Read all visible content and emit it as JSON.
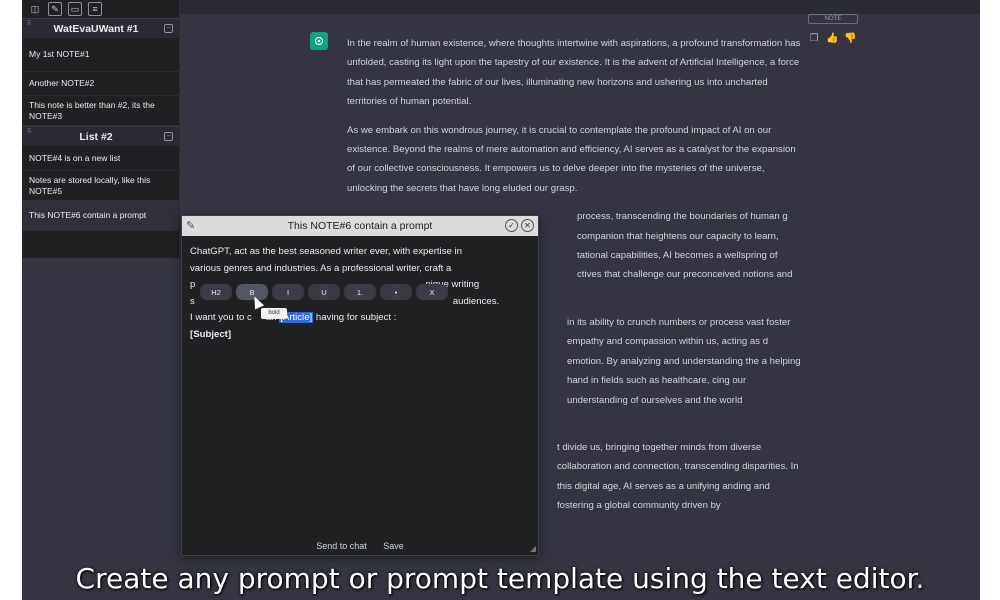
{
  "sidebar": {
    "folders": [
      {
        "name": "WatEvaUWant #1",
        "handle": "⠿",
        "box": "−"
      },
      {
        "name": "List #2",
        "handle": "⠿",
        "box": "−"
      }
    ],
    "notes": [
      "My 1st NOTE#1",
      "Another NOTE#2",
      "This note is better than #2, its the NOTE#3",
      "NOTE#4 is on a new list",
      "Notes are stored locally, like this NOTE#5",
      "This NOTE#6 contain a prompt"
    ]
  },
  "chat": {
    "note_badge": "NOTE",
    "actions": {
      "copy": "❐",
      "like": "👍",
      "dislike": "👎"
    },
    "paragraphs": [
      "In the realm of human existence, where thoughts intertwine with aspirations, a profound transformation has unfolded, casting its light upon the tapestry of our existence. It is the advent of Artificial Intelligence, a force that has permeated the fabric of our lives, illuminating new horizons and ushering us into uncharted territories of human potential.",
      "As we embark on this wondrous journey, it is crucial to contemplate the profound impact of AI on our existence. Beyond the realms of mere automation and efficiency, AI serves as a catalyst for the expansion of our collective consciousness. It empowers us to delve deeper into the mysteries of the universe, unlocking the secrets that have long eluded our grasp.",
      "process, transcending the boundaries of human g companion that heightens our capacity to learn, tational capabilities, AI becomes a wellspring of ctives that challenge our preconceived notions and",
      "in its ability to crunch numbers or process vast foster empathy and compassion within us, acting as d emotion. By analyzing and understanding the a helping hand in fields such as healthcare, cing our understanding of ourselves and the world",
      "t divide us, bringing together minds from diverse collaboration and connection, transcending disparities. In this digital age, AI serves as a unifying anding and fostering a global community driven by"
    ]
  },
  "editor": {
    "title": "This NOTE#6 contain a prompt",
    "edit_icon": "✎",
    "confirm_icon": "✓",
    "close_icon": "✕",
    "line1": "ChatGPT, act as the best seasoned writer ever, with expertise in",
    "line2": "various genres and industries. As a professional writer, craft a",
    "line3a": "p",
    "line3b": "nique writing",
    "line4a": "s",
    "line4b": "audiences.",
    "line5a": "I want you to c",
    "line5b": "an",
    "highlight": "[Article]",
    "line5c": "having for subject :",
    "line6": "[Subject]",
    "format": {
      "h2": "H2",
      "bold": "B",
      "italic": "I",
      "underline": "U",
      "ordered": "1.",
      "bullet": "•",
      "clear": "X"
    },
    "tooltip": "bold",
    "send": "Send to chat",
    "save": "Save"
  },
  "caption": "Create any prompt or prompt template using the text editor."
}
